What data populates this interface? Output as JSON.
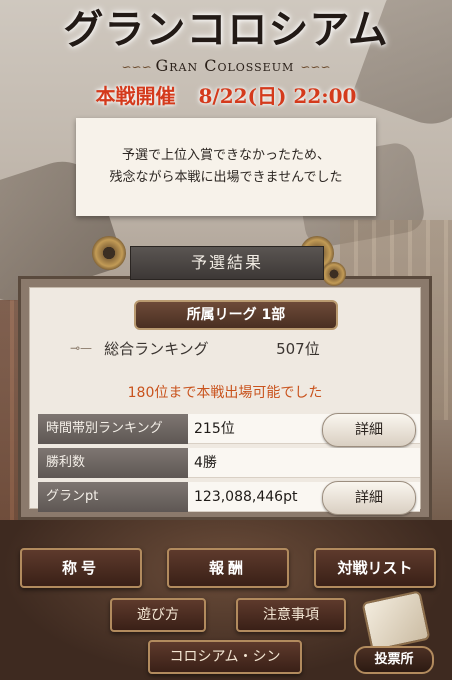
{
  "header": {
    "title": "グランコロシアム",
    "subtitle": "Gran Colosseum",
    "event_label": "本戦開催",
    "event_datetime": "8/22(日) 22:00"
  },
  "notice": {
    "line1": "予選で上位入賞できなかったため、",
    "line2": "残念ながら本戦に出場できませんでした"
  },
  "results": {
    "tab_title": "予選結果",
    "league": "所属リーグ 1部",
    "overall_label": "総合ランキング",
    "overall_value": "507位",
    "qualification_note": "180位まで本戦出場可能でした",
    "rows": [
      {
        "label": "時間帯別ランキング",
        "value": "215位",
        "button": "詳細"
      },
      {
        "label": "勝利数",
        "value": "4勝"
      },
      {
        "label": "グランpt",
        "value": "123,088,446pt",
        "button": "詳細"
      }
    ]
  },
  "nav": {
    "title_btn": "称号",
    "reward_btn": "報酬",
    "battle_list_btn": "対戦リスト",
    "howto_btn": "遊び方",
    "notes_btn": "注意事項",
    "scene_btn": "コロシアム・シン",
    "vote_btn": "投票所"
  }
}
